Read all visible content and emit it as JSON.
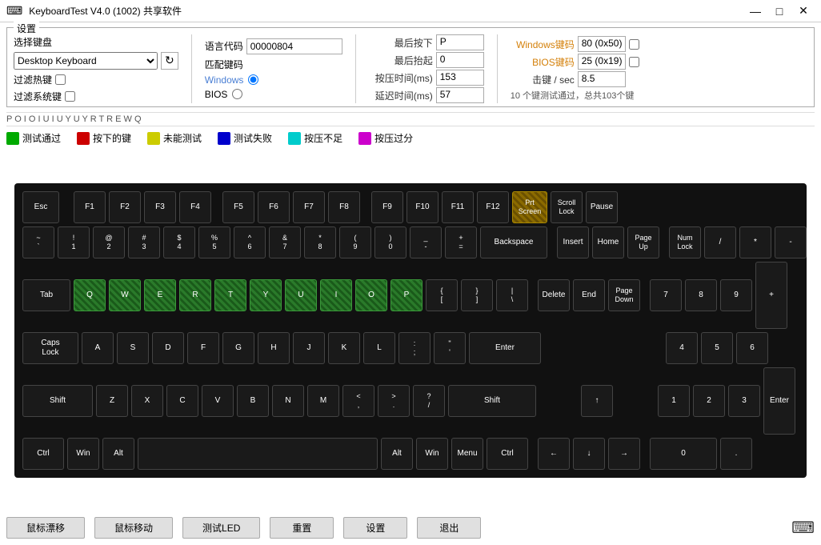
{
  "app": {
    "title": "KeyboardTest V4.0 (1002) 共享软件",
    "icon": "⌨"
  },
  "titlebar": {
    "minimize": "—",
    "maximize": "□",
    "close": "✕"
  },
  "settings": {
    "section_label": "设置",
    "keyboard_label": "选择键盘",
    "keyboard_value": "Desktop Keyboard",
    "filter_hotkeys": "过滤热键",
    "filter_system": "过滤系统键",
    "language_code_label": "语言代码",
    "language_code_value": "00000804",
    "match_code_label": "匹配键码",
    "windows_label": "Windows",
    "bios_label": "BIOS"
  },
  "stats": {
    "last_press_label": "最后按下",
    "last_press_value": "P",
    "last_release_label": "最后抬起",
    "last_release_value": "0",
    "press_time_label": "按压时间(ms)",
    "press_time_value": "153",
    "delay_time_label": "延迟时间(ms)",
    "delay_time_value": "57",
    "windows_code_label": "Windows键码",
    "windows_code_value": "80 (0x50)",
    "bios_code_label": "BIOS键码",
    "bios_code_value": "25 (0x19)",
    "hit_rate_label": "击键 / sec",
    "hit_rate_value": "8.5",
    "summary": "10 个键测试通过，总共103个键"
  },
  "key_log": "P O I O I U I U Y U Y R T R E W Q",
  "legend": [
    {
      "label": "测试通过",
      "color": "#00aa00"
    },
    {
      "label": "按下的键",
      "color": "#cc0000"
    },
    {
      "label": "未能测试",
      "color": "#cccc00"
    },
    {
      "label": "测试失败",
      "color": "#0000cc"
    },
    {
      "label": "按压不足",
      "color": "#00cccc"
    },
    {
      "label": "按压过分",
      "color": "#cc00cc"
    }
  ],
  "buttons": {
    "mouse_hover": "鼠标漂移",
    "mouse_move": "鼠标移动",
    "test_led": "测试LED",
    "reset": "重置",
    "settings": "设置",
    "exit": "退出"
  },
  "keyboard": {
    "rows": {
      "fn_row": [
        "Esc",
        "F1",
        "F2",
        "F3",
        "F4",
        "F5",
        "F6",
        "F7",
        "F8",
        "F9",
        "F10",
        "F11",
        "F12",
        "PrtScn",
        "Scroll Lock",
        "Pause"
      ],
      "num_row": [
        "~\n`",
        "!\n1",
        "@\n2",
        "#\n3",
        "$\n4",
        "%\n5",
        "^\n6",
        "&\n7",
        "*\n8",
        "(\n9",
        ")\n0",
        "_\n-",
        "+\n=",
        "Backspace"
      ],
      "tab_row": [
        "Tab",
        "Q",
        "W",
        "E",
        "R",
        "T",
        "Y",
        "U",
        "I",
        "O",
        "P",
        "{\n[",
        "}\n]",
        "|\n\\"
      ],
      "caps_row": [
        "Caps Lock",
        "A",
        "S",
        "D",
        "F",
        "G",
        "H",
        "J",
        "K",
        "L",
        ":\n;",
        "\"\n'",
        "Enter"
      ],
      "shift_row": [
        "Shift",
        "Z",
        "X",
        "C",
        "V",
        "B",
        "N",
        "M",
        "<\n,",
        ">\n.",
        "?\n/",
        "Shift"
      ],
      "ctrl_row": [
        "Ctrl",
        "Win",
        "Alt",
        "Alt",
        "Win",
        "Menu",
        "Ctrl"
      ]
    }
  }
}
